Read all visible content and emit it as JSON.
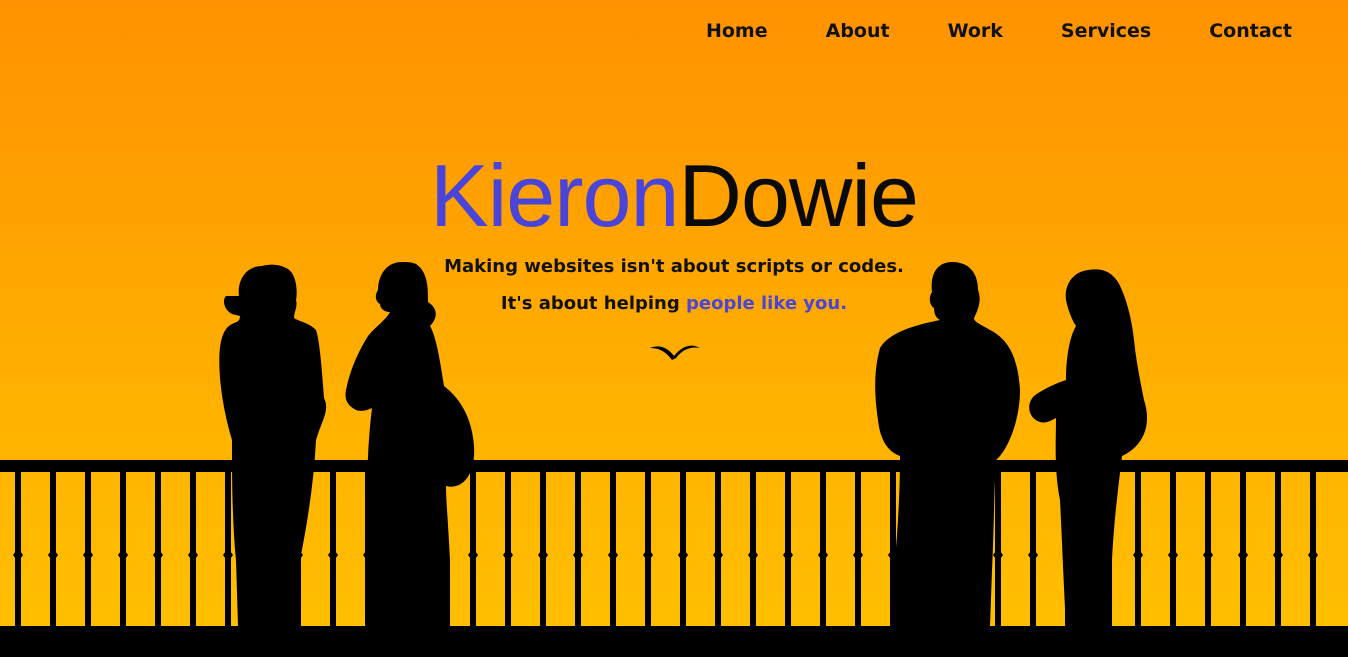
{
  "nav": {
    "items": [
      {
        "label": "Home"
      },
      {
        "label": "About"
      },
      {
        "label": "Work"
      },
      {
        "label": "Services"
      },
      {
        "label": "Contact"
      }
    ]
  },
  "logo": {
    "first": "Kieron",
    "last": "Dowie"
  },
  "tagline": {
    "line1": "Making websites isn't about scripts or codes.",
    "line2_prefix": "It's about helping ",
    "line2_accent": "people like you."
  },
  "colors": {
    "accent": "#4a45d8",
    "text": "#111111",
    "sky_top": "#ff9200",
    "sky_bottom": "#ffc000"
  },
  "icons": {
    "scroll_hint": "bird-icon"
  }
}
